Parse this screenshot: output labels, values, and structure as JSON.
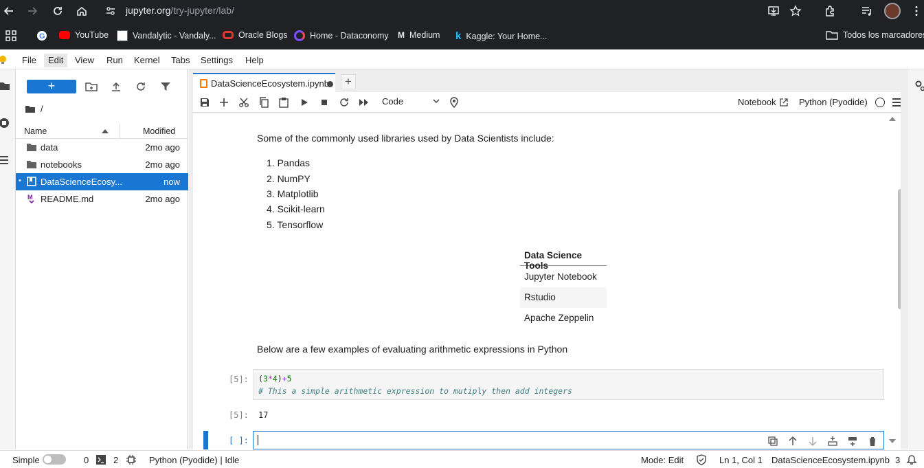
{
  "browser": {
    "url_host": "jupyter.org",
    "url_path": "/try-jupyter/lab/",
    "bookmarks": [
      {
        "label": "YouTube",
        "icon": "youtube-icon"
      },
      {
        "label": "Vandalytic - Vandaly...",
        "icon": "vandalytic-icon"
      },
      {
        "label": "Oracle Blogs",
        "icon": "oracle-icon"
      },
      {
        "label": "Home - Dataconomy",
        "icon": "dataconomy-icon"
      },
      {
        "label": "Medium",
        "icon": "medium-icon"
      },
      {
        "label": "Kaggle: Your Home...",
        "icon": "kaggle-icon"
      }
    ],
    "all_bookmarks": "Todos los marcadores"
  },
  "menubar": {
    "items": [
      "File",
      "Edit",
      "View",
      "Run",
      "Kernel",
      "Tabs",
      "Settings",
      "Help"
    ]
  },
  "filebrowser": {
    "new_label": "+",
    "breadcrumb": "/",
    "col_name": "Name",
    "col_modified": "Modified",
    "rows": [
      {
        "name": "data",
        "modified": "2mo ago",
        "type": "folder"
      },
      {
        "name": "notebooks",
        "modified": "2mo ago",
        "type": "folder"
      },
      {
        "name": "DataScienceEcosy...",
        "modified": "now",
        "type": "notebook"
      },
      {
        "name": "README.md",
        "modified": "2mo ago",
        "type": "markdown"
      }
    ]
  },
  "notebook": {
    "tab_title": "DataScienceEcosystem.ipynb",
    "tab_add": "+",
    "cell_type": "Code",
    "notebook_label": "Notebook",
    "kernel_label": "Python (Pyodide)",
    "intro_text": "Some of the commonly used libraries used by Data Scientists include:",
    "libraries": [
      "1. Pandas",
      "2. NumPY",
      "3. Matplotlib",
      "4. Scikit-learn",
      "5. Tensorflow"
    ],
    "table": {
      "header": "Data Science Tools",
      "rows": [
        "Jupyter Notebook",
        "Rstudio",
        "Apache Zeppelin"
      ]
    },
    "examples_text": "Below are a few examples of evaluating arithmetic expressions in Python",
    "code_prompt": "[5]:",
    "code_line1_parts": [
      "(",
      "3",
      "*",
      "4",
      ")",
      "+",
      "5"
    ],
    "code_line2": "# This a simple arithmetic expression to mutiply then add integers",
    "output_prompt": "[5]:",
    "output_value": "17",
    "active_prompt": "[ ]:"
  },
  "statusbar": {
    "mode_label": "Simple",
    "terminals": "0",
    "kernels": "2",
    "kernel_status": "Python (Pyodide) | Idle",
    "edit_mode": "Mode: Edit",
    "cursor_pos": "Ln 1, Col 1",
    "filename": "DataScienceEcosystem.ipynb",
    "notifications": "3"
  },
  "colors": {
    "accent": "#1976d2",
    "chrome_bg": "#202124",
    "notebook_tab_icon": "#f57c00"
  }
}
